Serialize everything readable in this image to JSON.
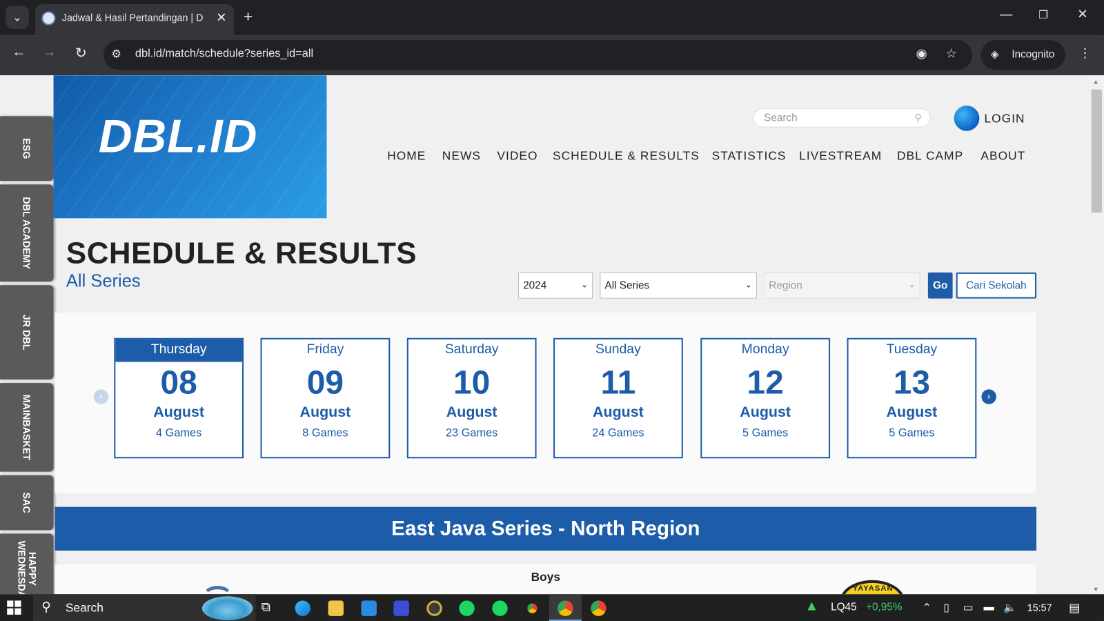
{
  "browser": {
    "tab_title": "Jadwal & Hasil Pertandingan | D",
    "tab_close": "✕",
    "new_tab": "+",
    "url": "dbl.id/match/schedule?series_id=all",
    "incognito_label": "Incognito"
  },
  "sidebar": {
    "tabs": [
      {
        "label": "ESG"
      },
      {
        "label": "DBL ACADEMY"
      },
      {
        "label": "JR DBL"
      },
      {
        "label": "MAINBASKET"
      },
      {
        "label": "SAC"
      },
      {
        "label": "HAPPY WEDNESDAY"
      }
    ]
  },
  "header": {
    "logo_text": "DBL.ID",
    "search_placeholder": "Search",
    "login_label": "LOGIN",
    "menu": [
      "HOME",
      "NEWS",
      "VIDEO",
      "SCHEDULE & RESULTS",
      "STATISTICS",
      "LIVESTREAM",
      "DBL CAMP",
      "ABOUT"
    ]
  },
  "page": {
    "title": "SCHEDULE & RESULTS",
    "subtitle": "All Series",
    "filters": {
      "year": "2024",
      "series": "All Series",
      "region_placeholder": "Region",
      "go_label": "Go",
      "find_school_label": "Cari Sekolah"
    }
  },
  "dates": [
    {
      "day": "Thursday",
      "date": "08",
      "month": "August",
      "games": "4 Games",
      "active": true
    },
    {
      "day": "Friday",
      "date": "09",
      "month": "August",
      "games": "8 Games",
      "active": false
    },
    {
      "day": "Saturday",
      "date": "10",
      "month": "August",
      "games": "23 Games",
      "active": false
    },
    {
      "day": "Sunday",
      "date": "11",
      "month": "August",
      "games": "24 Games",
      "active": false
    },
    {
      "day": "Monday",
      "date": "12",
      "month": "August",
      "games": "5 Games",
      "active": false
    },
    {
      "day": "Tuesday",
      "date": "13",
      "month": "August",
      "games": "5 Games",
      "active": false
    }
  ],
  "region_banner": "East Java Series - North Region",
  "division_label": "Boys",
  "team_logo_text": "YAYASAN",
  "taskbar": {
    "search_label": "Search",
    "stock_name": "LQ45",
    "stock_change": "+0,95%",
    "time": "15:57"
  },
  "colors": {
    "brand_blue": "#1c5ca8",
    "stock_up": "#3fd06a"
  }
}
